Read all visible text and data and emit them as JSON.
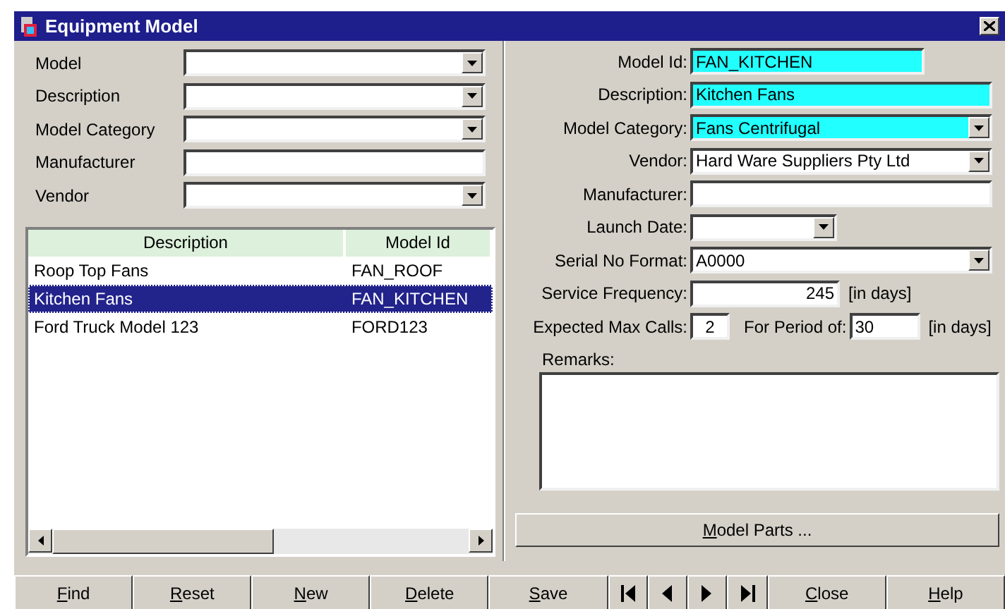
{
  "window": {
    "title": "Equipment Model"
  },
  "filters": [
    {
      "label": "Model",
      "kind": "dropdown"
    },
    {
      "label": "Description",
      "kind": "dropdown"
    },
    {
      "label": "Model Category",
      "kind": "dropdown"
    },
    {
      "label": "Manufacturer",
      "kind": "text"
    },
    {
      "label": "Vendor",
      "kind": "dropdown"
    }
  ],
  "table": {
    "columns": [
      "Description",
      "Model Id"
    ],
    "rows": [
      {
        "cells": [
          "Roop Top Fans",
          "FAN_ROOF"
        ],
        "selected": false
      },
      {
        "cells": [
          "Kitchen Fans",
          "FAN_KITCHEN"
        ],
        "selected": true
      },
      {
        "cells": [
          "Ford Truck Model 123",
          "FORD123"
        ],
        "selected": false
      }
    ]
  },
  "details": [
    {
      "label": "Model Id:",
      "kind": "code",
      "value": "FAN_KITCHEN",
      "highlighted": true
    },
    {
      "label": "Description:",
      "kind": "text",
      "value": "Kitchen Fans",
      "highlighted": true
    },
    {
      "label": "Model Category:",
      "kind": "dropdown",
      "value": "Fans Centrifugal",
      "highlighted": true
    },
    {
      "label": "Vendor:",
      "kind": "dropdown",
      "value": "Hard Ware Suppliers Pty Ltd",
      "highlighted": false
    },
    {
      "label": "Manufacturer:",
      "kind": "text",
      "highlighted": false
    },
    {
      "label": "Launch Date:",
      "kind": "date",
      "highlighted": false
    },
    {
      "label": "Serial No Format:",
      "kind": "dropdown",
      "value": "A0000",
      "highlighted": false
    }
  ],
  "service_frequency": {
    "label": "Service Frequency:",
    "value": "245",
    "unit": "[in days]"
  },
  "expected_calls": {
    "label": "Expected Max Calls:",
    "value": "2",
    "period_label": "For Period of:",
    "period_value": "30",
    "unit": "[in days]"
  },
  "remarks": {
    "label": "Remarks:"
  },
  "model_parts_button": {
    "label": "Model Parts ...",
    "mnemonic": true
  },
  "buttons": [
    {
      "kind": "text",
      "label": "Find",
      "mnemonic": true
    },
    {
      "kind": "text",
      "label": "Reset",
      "mnemonic": true
    },
    {
      "kind": "text",
      "label": "New",
      "mnemonic": true
    },
    {
      "kind": "text",
      "label": "Delete",
      "mnemonic": true
    },
    {
      "kind": "text",
      "label": "Save",
      "mnemonic": true
    },
    {
      "kind": "first"
    },
    {
      "kind": "previous"
    },
    {
      "kind": "next"
    },
    {
      "kind": "last"
    },
    {
      "kind": "text",
      "label": "Close",
      "mnemonic": true
    },
    {
      "kind": "text",
      "label": "Help",
      "mnemonic": true
    }
  ]
}
